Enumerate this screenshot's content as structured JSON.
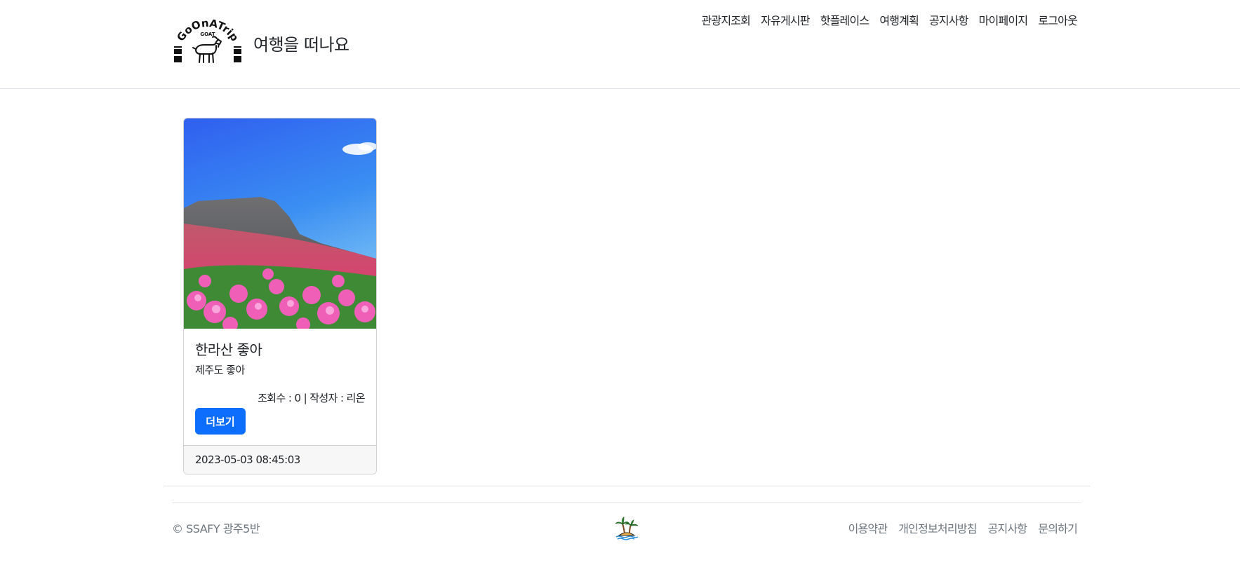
{
  "header": {
    "logo_icon": "goat-logo-icon",
    "logo": {
      "word": "GoOnATrip",
      "sub": "GOAT"
    },
    "title": "여행을 떠나요",
    "nav": [
      {
        "label": "관광지조회"
      },
      {
        "label": "자유게시판"
      },
      {
        "label": "핫플레이스"
      },
      {
        "label": "여행계획"
      },
      {
        "label": "공지사항"
      },
      {
        "label": "마이페이지"
      },
      {
        "label": "로그아웃"
      }
    ]
  },
  "card": {
    "image_icon": "mountain-flowers-photo",
    "title": "한라산 좋아",
    "text": "제주도 좋아",
    "meta": "조회수 : 0 | 작성자 : 리온",
    "button": "더보기",
    "date": "2023-05-03 08:45:03"
  },
  "footer": {
    "copyright": "© SSAFY 광주5반",
    "icon": "palm-island-icon",
    "links": [
      {
        "label": "이용약관"
      },
      {
        "label": "개인정보처리방침"
      },
      {
        "label": "공지사항"
      },
      {
        "label": "문의하기"
      }
    ]
  },
  "colors": {
    "primary": "#0d6efd",
    "muted": "#6c757d",
    "text": "#212529",
    "card_footer_bg": "#f7f7f7",
    "border": "#dee2e6"
  }
}
